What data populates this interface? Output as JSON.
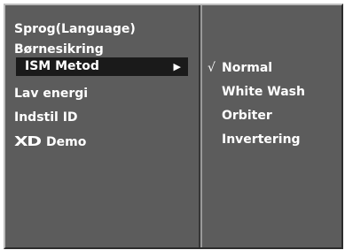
{
  "menu": {
    "items": [
      {
        "label": "Sprog(Language)"
      },
      {
        "label": "Børnesikring"
      },
      {
        "label": "ISM Metod",
        "arrow": "▶"
      },
      {
        "label": "Lav energi"
      },
      {
        "label": "Indstil ID"
      },
      {
        "logo": "XD",
        "label": "Demo"
      }
    ],
    "selected_index": 2
  },
  "submenu": {
    "check_mark": "√",
    "selected_index": 0,
    "options": [
      {
        "label": "Normal"
      },
      {
        "label": "White Wash"
      },
      {
        "label": "Orbiter"
      },
      {
        "label": "Invertering"
      }
    ]
  },
  "colors": {
    "panel_bg": "#5c5c5c",
    "highlight_bg": "#1a1a1a",
    "text": "#ffffff"
  }
}
